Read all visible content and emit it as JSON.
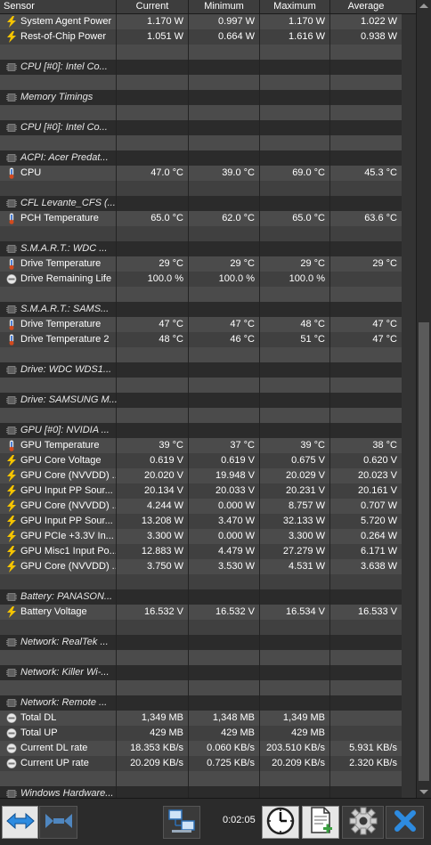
{
  "header": {
    "sensor": "Sensor",
    "current": "Current",
    "minimum": "Minimum",
    "maximum": "Maximum",
    "average": "Average"
  },
  "rows": [
    {
      "type": "sensor",
      "icon": "bolt-icon",
      "name": "System Agent Power",
      "current": "1.170 W",
      "minimum": "0.997 W",
      "maximum": "1.170 W",
      "average": "1.022 W"
    },
    {
      "type": "sensor",
      "icon": "bolt-icon",
      "name": "Rest-of-Chip Power",
      "current": "1.051 W",
      "minimum": "0.664 W",
      "maximum": "1.616 W",
      "average": "0.938 W"
    },
    {
      "type": "blank"
    },
    {
      "type": "group",
      "icon": "chip-icon",
      "name": "CPU [#0]: Intel Co..."
    },
    {
      "type": "blank"
    },
    {
      "type": "group",
      "icon": "chip-icon",
      "name": "Memory Timings"
    },
    {
      "type": "blank"
    },
    {
      "type": "group",
      "icon": "chip-icon",
      "name": "CPU [#0]: Intel Co..."
    },
    {
      "type": "blank"
    },
    {
      "type": "group",
      "icon": "chip-icon",
      "name": "ACPI: Acer Predat..."
    },
    {
      "type": "sensor",
      "icon": "thermometer-icon",
      "name": "CPU",
      "current": "47.0 °C",
      "minimum": "39.0 °C",
      "maximum": "69.0 °C",
      "average": "45.3 °C"
    },
    {
      "type": "blank"
    },
    {
      "type": "group",
      "icon": "chip-icon",
      "name": "CFL Levante_CFS (..."
    },
    {
      "type": "sensor",
      "icon": "thermometer-icon",
      "name": "PCH Temperature",
      "current": "65.0 °C",
      "minimum": "62.0 °C",
      "maximum": "65.0 °C",
      "average": "63.6 °C"
    },
    {
      "type": "blank"
    },
    {
      "type": "group",
      "icon": "chip-icon",
      "name": "S.M.A.R.T.: WDC ..."
    },
    {
      "type": "sensor",
      "icon": "thermometer-icon",
      "name": "Drive Temperature",
      "current": "29 °C",
      "minimum": "29 °C",
      "maximum": "29 °C",
      "average": "29 °C"
    },
    {
      "type": "sensor",
      "icon": "gauge-icon",
      "name": "Drive Remaining Life",
      "current": "100.0 %",
      "minimum": "100.0 %",
      "maximum": "100.0 %",
      "average": ""
    },
    {
      "type": "blank"
    },
    {
      "type": "group",
      "icon": "chip-icon",
      "name": "S.M.A.R.T.: SAMS..."
    },
    {
      "type": "sensor",
      "icon": "thermometer-icon",
      "name": "Drive Temperature",
      "current": "47 °C",
      "minimum": "47 °C",
      "maximum": "48 °C",
      "average": "47 °C"
    },
    {
      "type": "sensor",
      "icon": "thermometer-icon",
      "name": "Drive Temperature 2",
      "current": "48 °C",
      "minimum": "46 °C",
      "maximum": "51 °C",
      "average": "47 °C"
    },
    {
      "type": "blank"
    },
    {
      "type": "group",
      "icon": "chip-icon",
      "name": "Drive: WDC  WDS1..."
    },
    {
      "type": "blank"
    },
    {
      "type": "group",
      "icon": "chip-icon",
      "name": "Drive: SAMSUNG M..."
    },
    {
      "type": "blank"
    },
    {
      "type": "group",
      "icon": "chip-icon",
      "name": "GPU [#0]: NVIDIA ..."
    },
    {
      "type": "sensor",
      "icon": "thermometer-icon",
      "name": "GPU Temperature",
      "current": "39 °C",
      "minimum": "37 °C",
      "maximum": "39 °C",
      "average": "38 °C"
    },
    {
      "type": "sensor",
      "icon": "bolt-icon",
      "name": "GPU Core Voltage",
      "current": "0.619 V",
      "minimum": "0.619 V",
      "maximum": "0.675 V",
      "average": "0.620 V"
    },
    {
      "type": "sensor",
      "icon": "bolt-icon",
      "name": "GPU Core (NVVDD) ...",
      "current": "20.020 V",
      "minimum": "19.948 V",
      "maximum": "20.029 V",
      "average": "20.023 V"
    },
    {
      "type": "sensor",
      "icon": "bolt-icon",
      "name": "GPU Input PP Sour...",
      "current": "20.134 V",
      "minimum": "20.033 V",
      "maximum": "20.231 V",
      "average": "20.161 V"
    },
    {
      "type": "sensor",
      "icon": "bolt-icon",
      "name": "GPU Core (NVVDD) ...",
      "current": "4.244 W",
      "minimum": "0.000 W",
      "maximum": "8.757 W",
      "average": "0.707 W"
    },
    {
      "type": "sensor",
      "icon": "bolt-icon",
      "name": "GPU Input PP Sour...",
      "current": "13.208 W",
      "minimum": "3.470 W",
      "maximum": "32.133 W",
      "average": "5.720 W"
    },
    {
      "type": "sensor",
      "icon": "bolt-icon",
      "name": "GPU PCIe +3.3V In...",
      "current": "3.300 W",
      "minimum": "0.000 W",
      "maximum": "3.300 W",
      "average": "0.264 W"
    },
    {
      "type": "sensor",
      "icon": "bolt-icon",
      "name": "GPU Misc1 Input Po...",
      "current": "12.883 W",
      "minimum": "4.479 W",
      "maximum": "27.279 W",
      "average": "6.171 W"
    },
    {
      "type": "sensor",
      "icon": "bolt-icon",
      "name": "GPU Core (NVVDD) ...",
      "current": "3.750 W",
      "minimum": "3.530 W",
      "maximum": "4.531 W",
      "average": "3.638 W"
    },
    {
      "type": "blank"
    },
    {
      "type": "group",
      "icon": "chip-icon",
      "name": "Battery: PANASON..."
    },
    {
      "type": "sensor",
      "icon": "bolt-icon",
      "name": "Battery Voltage",
      "current": "16.532 V",
      "minimum": "16.532 V",
      "maximum": "16.534 V",
      "average": "16.533 V"
    },
    {
      "type": "blank"
    },
    {
      "type": "group",
      "icon": "chip-icon",
      "name": "Network: RealTek ..."
    },
    {
      "type": "blank"
    },
    {
      "type": "group",
      "icon": "chip-icon",
      "name": "Network: Killer Wi-..."
    },
    {
      "type": "blank"
    },
    {
      "type": "group",
      "icon": "chip-icon",
      "name": "Network: Remote ..."
    },
    {
      "type": "sensor",
      "icon": "gauge-icon",
      "name": "Total DL",
      "current": "1,349 MB",
      "minimum": "1,348 MB",
      "maximum": "1,349 MB",
      "average": ""
    },
    {
      "type": "sensor",
      "icon": "gauge-icon",
      "name": "Total UP",
      "current": "429 MB",
      "minimum": "429 MB",
      "maximum": "429 MB",
      "average": ""
    },
    {
      "type": "sensor",
      "icon": "gauge-icon",
      "name": "Current DL rate",
      "current": "18.353 KB/s",
      "minimum": "0.060 KB/s",
      "maximum": "203.510 KB/s",
      "average": "5.931 KB/s"
    },
    {
      "type": "sensor",
      "icon": "gauge-icon",
      "name": "Current UP rate",
      "current": "20.209 KB/s",
      "minimum": "0.725 KB/s",
      "maximum": "20.209 KB/s",
      "average": "2.320 KB/s"
    },
    {
      "type": "blank"
    },
    {
      "type": "group",
      "icon": "chip-icon",
      "name": "Windows Hardware..."
    }
  ],
  "toolbar": {
    "elapsed_time": "0:02:05",
    "icons": [
      "expand-arrows-icon",
      "collapse-arrows-icon",
      "network-computers-icon",
      "clock-icon",
      "add-report-icon",
      "gear-icon",
      "close-icon"
    ]
  },
  "colors": {
    "bolt": "#f5c400",
    "thermometer_bulb": "#d24a1e",
    "thermometer_tube": "#4a7fd6",
    "accent_blue": "#2d8be0"
  }
}
